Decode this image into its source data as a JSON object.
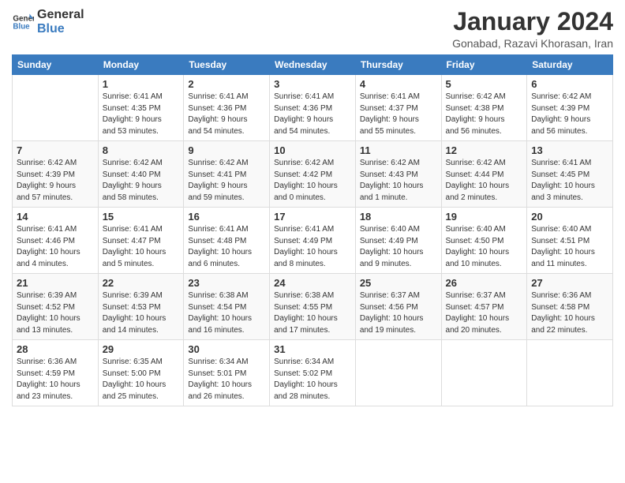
{
  "header": {
    "logo_general": "General",
    "logo_blue": "Blue",
    "title": "January 2024",
    "subtitle": "Gonabad, Razavi Khorasan, Iran"
  },
  "weekdays": [
    "Sunday",
    "Monday",
    "Tuesday",
    "Wednesday",
    "Thursday",
    "Friday",
    "Saturday"
  ],
  "weeks": [
    [
      {
        "day": "",
        "info": ""
      },
      {
        "day": "1",
        "info": "Sunrise: 6:41 AM\nSunset: 4:35 PM\nDaylight: 9 hours\nand 53 minutes."
      },
      {
        "day": "2",
        "info": "Sunrise: 6:41 AM\nSunset: 4:36 PM\nDaylight: 9 hours\nand 54 minutes."
      },
      {
        "day": "3",
        "info": "Sunrise: 6:41 AM\nSunset: 4:36 PM\nDaylight: 9 hours\nand 54 minutes."
      },
      {
        "day": "4",
        "info": "Sunrise: 6:41 AM\nSunset: 4:37 PM\nDaylight: 9 hours\nand 55 minutes."
      },
      {
        "day": "5",
        "info": "Sunrise: 6:42 AM\nSunset: 4:38 PM\nDaylight: 9 hours\nand 56 minutes."
      },
      {
        "day": "6",
        "info": "Sunrise: 6:42 AM\nSunset: 4:39 PM\nDaylight: 9 hours\nand 56 minutes."
      }
    ],
    [
      {
        "day": "7",
        "info": "Sunrise: 6:42 AM\nSunset: 4:39 PM\nDaylight: 9 hours\nand 57 minutes."
      },
      {
        "day": "8",
        "info": "Sunrise: 6:42 AM\nSunset: 4:40 PM\nDaylight: 9 hours\nand 58 minutes."
      },
      {
        "day": "9",
        "info": "Sunrise: 6:42 AM\nSunset: 4:41 PM\nDaylight: 9 hours\nand 59 minutes."
      },
      {
        "day": "10",
        "info": "Sunrise: 6:42 AM\nSunset: 4:42 PM\nDaylight: 10 hours\nand 0 minutes."
      },
      {
        "day": "11",
        "info": "Sunrise: 6:42 AM\nSunset: 4:43 PM\nDaylight: 10 hours\nand 1 minute."
      },
      {
        "day": "12",
        "info": "Sunrise: 6:42 AM\nSunset: 4:44 PM\nDaylight: 10 hours\nand 2 minutes."
      },
      {
        "day": "13",
        "info": "Sunrise: 6:41 AM\nSunset: 4:45 PM\nDaylight: 10 hours\nand 3 minutes."
      }
    ],
    [
      {
        "day": "14",
        "info": "Sunrise: 6:41 AM\nSunset: 4:46 PM\nDaylight: 10 hours\nand 4 minutes."
      },
      {
        "day": "15",
        "info": "Sunrise: 6:41 AM\nSunset: 4:47 PM\nDaylight: 10 hours\nand 5 minutes."
      },
      {
        "day": "16",
        "info": "Sunrise: 6:41 AM\nSunset: 4:48 PM\nDaylight: 10 hours\nand 6 minutes."
      },
      {
        "day": "17",
        "info": "Sunrise: 6:41 AM\nSunset: 4:49 PM\nDaylight: 10 hours\nand 8 minutes."
      },
      {
        "day": "18",
        "info": "Sunrise: 6:40 AM\nSunset: 4:49 PM\nDaylight: 10 hours\nand 9 minutes."
      },
      {
        "day": "19",
        "info": "Sunrise: 6:40 AM\nSunset: 4:50 PM\nDaylight: 10 hours\nand 10 minutes."
      },
      {
        "day": "20",
        "info": "Sunrise: 6:40 AM\nSunset: 4:51 PM\nDaylight: 10 hours\nand 11 minutes."
      }
    ],
    [
      {
        "day": "21",
        "info": "Sunrise: 6:39 AM\nSunset: 4:52 PM\nDaylight: 10 hours\nand 13 minutes."
      },
      {
        "day": "22",
        "info": "Sunrise: 6:39 AM\nSunset: 4:53 PM\nDaylight: 10 hours\nand 14 minutes."
      },
      {
        "day": "23",
        "info": "Sunrise: 6:38 AM\nSunset: 4:54 PM\nDaylight: 10 hours\nand 16 minutes."
      },
      {
        "day": "24",
        "info": "Sunrise: 6:38 AM\nSunset: 4:55 PM\nDaylight: 10 hours\nand 17 minutes."
      },
      {
        "day": "25",
        "info": "Sunrise: 6:37 AM\nSunset: 4:56 PM\nDaylight: 10 hours\nand 19 minutes."
      },
      {
        "day": "26",
        "info": "Sunrise: 6:37 AM\nSunset: 4:57 PM\nDaylight: 10 hours\nand 20 minutes."
      },
      {
        "day": "27",
        "info": "Sunrise: 6:36 AM\nSunset: 4:58 PM\nDaylight: 10 hours\nand 22 minutes."
      }
    ],
    [
      {
        "day": "28",
        "info": "Sunrise: 6:36 AM\nSunset: 4:59 PM\nDaylight: 10 hours\nand 23 minutes."
      },
      {
        "day": "29",
        "info": "Sunrise: 6:35 AM\nSunset: 5:00 PM\nDaylight: 10 hours\nand 25 minutes."
      },
      {
        "day": "30",
        "info": "Sunrise: 6:34 AM\nSunset: 5:01 PM\nDaylight: 10 hours\nand 26 minutes."
      },
      {
        "day": "31",
        "info": "Sunrise: 6:34 AM\nSunset: 5:02 PM\nDaylight: 10 hours\nand 28 minutes."
      },
      {
        "day": "",
        "info": ""
      },
      {
        "day": "",
        "info": ""
      },
      {
        "day": "",
        "info": ""
      }
    ]
  ]
}
